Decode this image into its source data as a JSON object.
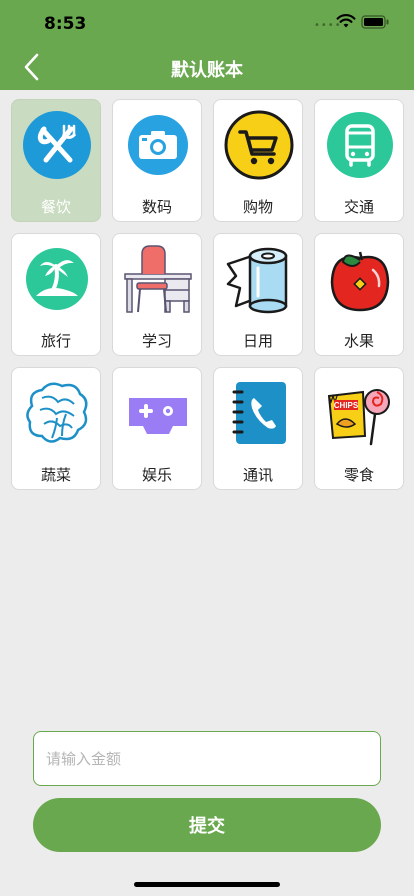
{
  "status_bar": {
    "time": "8:53"
  },
  "header": {
    "title": "默认账本"
  },
  "categories": [
    {
      "label": "餐饮",
      "icon": "fork-knife-icon",
      "selected": true
    },
    {
      "label": "数码",
      "icon": "camera-icon",
      "selected": false
    },
    {
      "label": "购物",
      "icon": "shopping-cart-icon",
      "selected": false
    },
    {
      "label": "交通",
      "icon": "bus-icon",
      "selected": false
    },
    {
      "label": "旅行",
      "icon": "palm-island-icon",
      "selected": false
    },
    {
      "label": "学习",
      "icon": "desk-chair-icon",
      "selected": false
    },
    {
      "label": "日用",
      "icon": "paper-roll-icon",
      "selected": false
    },
    {
      "label": "水果",
      "icon": "apple-icon",
      "selected": false
    },
    {
      "label": "蔬菜",
      "icon": "cabbage-icon",
      "selected": false
    },
    {
      "label": "娱乐",
      "icon": "gamepad-icon",
      "selected": false
    },
    {
      "label": "通讯",
      "icon": "phone-book-icon",
      "selected": false
    },
    {
      "label": "零食",
      "icon": "snacks-icon",
      "selected": false
    }
  ],
  "snack_icon_text": "CHIPS",
  "form": {
    "amount_placeholder": "请输入金额",
    "amount_value": "",
    "submit_label": "提交"
  },
  "colors": {
    "header": "#6aa84f",
    "selected_cell": "#c9dbc0",
    "background": "#ececec"
  }
}
